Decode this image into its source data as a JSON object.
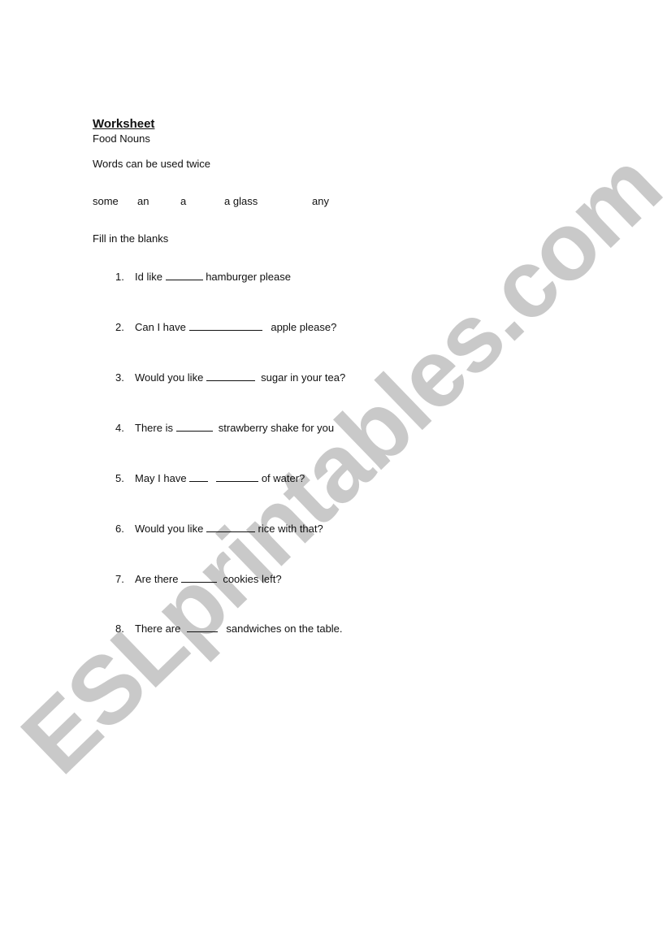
{
  "document": {
    "title": "Worksheet",
    "subtitle": "Food Nouns",
    "note": "Words can be used twice",
    "word_bank": [
      "some",
      "an",
      "a",
      "a glass",
      "any"
    ],
    "instruction": "Fill in the blanks",
    "questions": [
      {
        "number": "1.",
        "before": "Id like ",
        "blanks": [
          "______"
        ],
        "after": " hamburger please"
      },
      {
        "number": "2.",
        "before": "Can I have ",
        "blanks": [
          "___________"
        ],
        "after": "   apple please?"
      },
      {
        "number": "3.",
        "before": "Would you like ",
        "blanks": [
          "________"
        ],
        "after": "  sugar in your tea?"
      },
      {
        "number": "4.",
        "before": "There is ",
        "blanks": [
          "______"
        ],
        "after": "  strawberry shake for you"
      },
      {
        "number": "5.",
        "before": "May I have ",
        "blanks": [
          "___",
          "_______"
        ],
        "after": " of water?"
      },
      {
        "number": "6.",
        "before": "Would you like ",
        "blanks": [
          "________"
        ],
        "after": " rice with that?"
      },
      {
        "number": "7.",
        "before": "Are there ",
        "blanks": [
          "______"
        ],
        "after": "  cookies left?"
      },
      {
        "number": "8.",
        "before": "There are  ",
        "blanks": [
          "_____"
        ],
        "after": "   sandwiches on the table."
      }
    ]
  },
  "watermark": {
    "text": "ESLprintables.com",
    "color": "#c9c9c9"
  }
}
